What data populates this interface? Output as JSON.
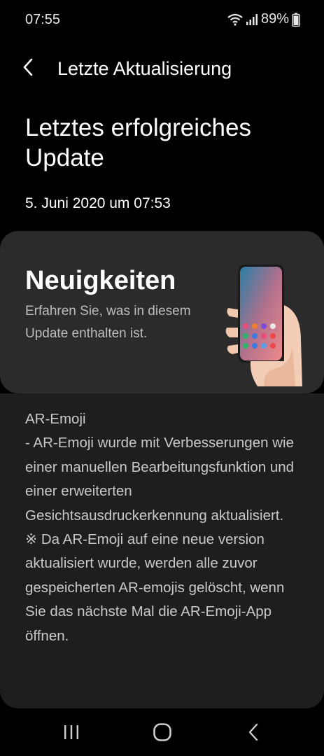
{
  "status_bar": {
    "time": "07:55",
    "battery": "89%",
    "icons": [
      "wifi-icon",
      "signal-icon",
      "battery-icon"
    ]
  },
  "app_bar": {
    "title": "Letzte Aktualisierung",
    "back_icon": "chevron-left-icon"
  },
  "header": {
    "title": "Letztes erfolgreiches Update",
    "date": "5. Juni 2020 um 07:53"
  },
  "news_card": {
    "title": "Neuigkeiten",
    "description": "Erfahren Sie, was in diesem Update enthalten ist.",
    "image": "phone-in-hand-illustration"
  },
  "release_notes": {
    "text": "AR-Emoji\n- AR-Emoji wurde mit Verbesserungen wie einer manuellen Bearbeitungsfunktion und einer erweiterten Gesichtsausdruckerkennung aktualisiert.\n※ Da AR-Emoji auf eine neue version aktualisiert wurde, werden alle zuvor gespeicherten AR-emojis gelöscht, wenn Sie das nächste Mal die AR-Emoji-App öffnen."
  },
  "nav_bar": {
    "icons": [
      "recents-icon",
      "home-icon",
      "back-icon"
    ]
  },
  "colors": {
    "background": "#000000",
    "card": "#2b2b2b",
    "panel": "#1e1e1e",
    "secondary_text": "#bdbdbd"
  }
}
